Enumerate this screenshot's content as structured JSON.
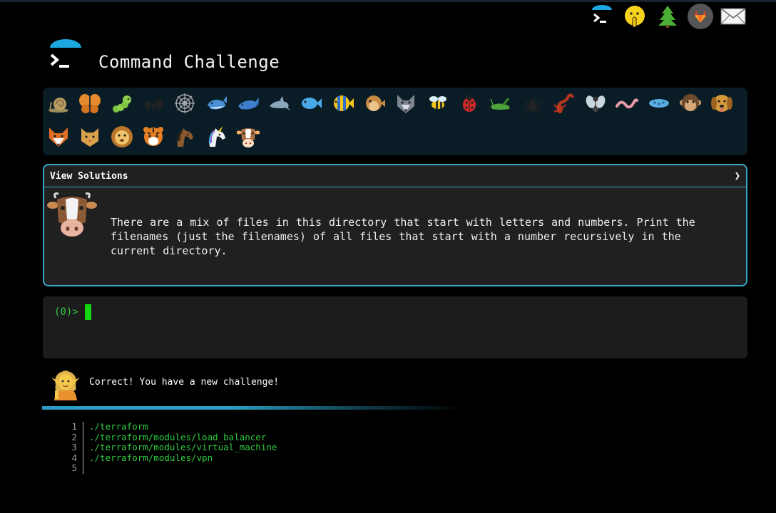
{
  "app": {
    "title": "Command Challenge"
  },
  "topnav": [
    {
      "name": "terminal-icon",
      "label": "Command Challenge"
    },
    {
      "name": "shush-face-icon",
      "label": "Secret"
    },
    {
      "name": "tree-icon",
      "label": "Tree"
    },
    {
      "name": "gitlab-icon",
      "label": "GitLab"
    },
    {
      "name": "mail-icon",
      "label": "Mail"
    }
  ],
  "animals": [
    "snail",
    "butterfly",
    "caterpillar",
    "ant",
    "spider-web",
    "whale",
    "whale-2",
    "dolphin",
    "fish",
    "tropical-fish",
    "blowfish",
    "wolf",
    "bee",
    "ladybug",
    "cricket",
    "spider",
    "scorpion",
    "fly",
    "worm",
    "microbe",
    "monkey",
    "dog",
    "fox",
    "cat",
    "lion",
    "tiger",
    "horse",
    "unicorn",
    "cow"
  ],
  "active_animal": "cow",
  "solutions": {
    "label": "View Solutions",
    "arrow": "❯"
  },
  "challenge": {
    "text": "There are a mix of files in this directory that start with letters and numbers. Print the filenames (just the filenames) of all files that start with a number recursively in the current directory."
  },
  "terminal": {
    "prompt": "(0)>"
  },
  "feedback": {
    "message": "Correct! You have a new challenge!"
  },
  "output": {
    "lines": [
      {
        "num": "1",
        "text": "./terraform"
      },
      {
        "num": "2",
        "text": "./terraform/modules/load_balancer"
      },
      {
        "num": "3",
        "text": "./terraform/modules/virtual_machine"
      },
      {
        "num": "4",
        "text": "./terraform/modules/vpn"
      },
      {
        "num": "5",
        "text": ""
      }
    ]
  },
  "colors": {
    "accent": "#2b9dc2",
    "prompt_green": "#2ecc40",
    "panel": "#0a1d26",
    "box_bg": "#202020"
  }
}
